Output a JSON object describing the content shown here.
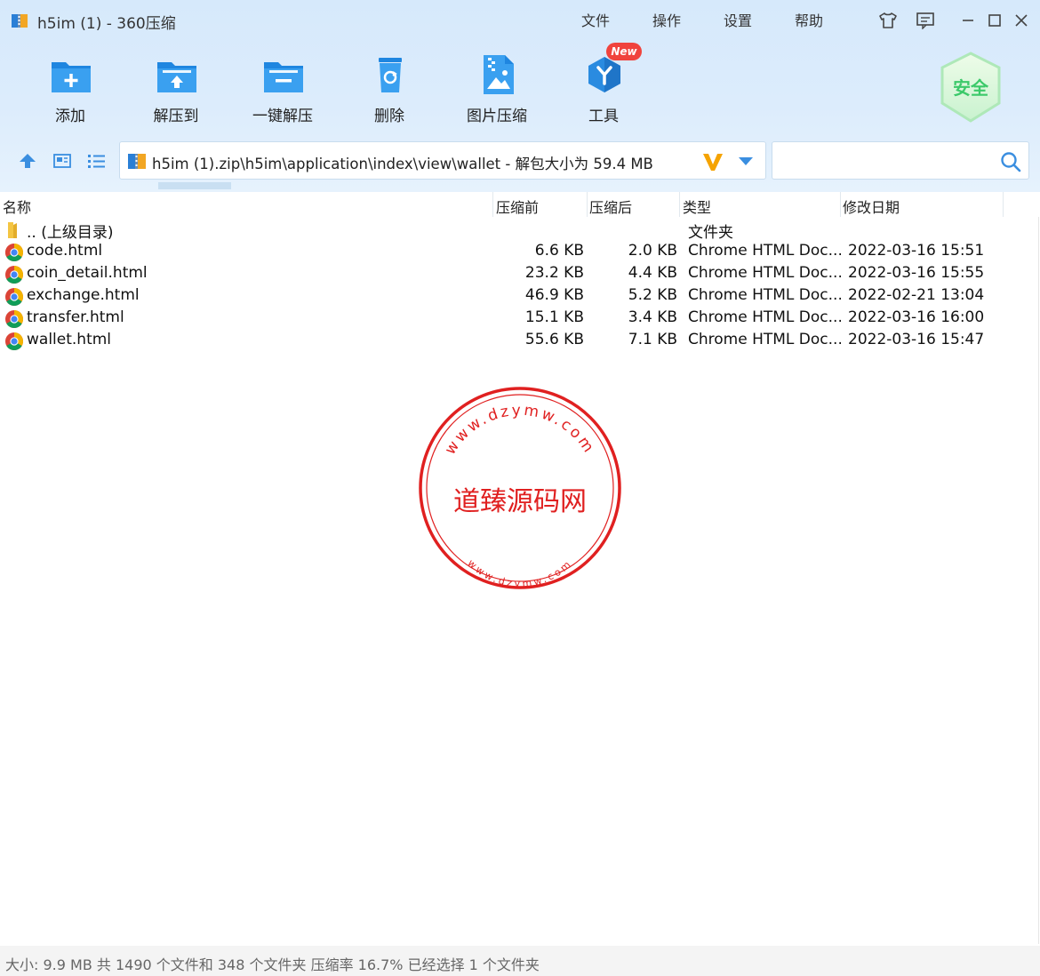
{
  "window": {
    "title": "h5im (1) - 360压缩"
  },
  "menu": {
    "file": "文件",
    "operate": "操作",
    "settings": "设置",
    "help": "帮助"
  },
  "toolbar": {
    "add": "添加",
    "extract_to": "解压到",
    "one_click": "一键解压",
    "delete": "删除",
    "image_compress": "图片压缩",
    "tools": "工具",
    "new_badge": "New"
  },
  "safe_badge": "安全",
  "address": {
    "path": "h5im (1).zip\\h5im\\application\\index\\view\\wallet - 解包大小为 59.4 MB"
  },
  "search": {
    "value": "",
    "placeholder": ""
  },
  "columns": {
    "name": "名称",
    "before": "压缩前",
    "after": "压缩后",
    "type": "类型",
    "date": "修改日期"
  },
  "files": [
    {
      "name": ".. (上级目录)",
      "before": "",
      "after": "",
      "type": "文件夹",
      "date": "",
      "icon": "folder-icon"
    },
    {
      "name": "code.html",
      "before": "6.6 KB",
      "after": "2.0 KB",
      "type": "Chrome HTML Doc...",
      "date": "2022-03-16 15:51",
      "icon": "chrome-icon"
    },
    {
      "name": "coin_detail.html",
      "before": "23.2 KB",
      "after": "4.4 KB",
      "type": "Chrome HTML Doc...",
      "date": "2022-03-16 15:55",
      "icon": "chrome-icon"
    },
    {
      "name": "exchange.html",
      "before": "46.9 KB",
      "after": "5.2 KB",
      "type": "Chrome HTML Doc...",
      "date": "2022-02-21 13:04",
      "icon": "chrome-icon"
    },
    {
      "name": "transfer.html",
      "before": "15.1 KB",
      "after": "3.4 KB",
      "type": "Chrome HTML Doc...",
      "date": "2022-03-16 16:00",
      "icon": "chrome-icon"
    },
    {
      "name": "wallet.html",
      "before": "55.6 KB",
      "after": "7.1 KB",
      "type": "Chrome HTML Doc...",
      "date": "2022-03-16 15:47",
      "icon": "chrome-icon"
    }
  ],
  "watermark": {
    "center": "道臻源码网",
    "top_arc": "www.dzymw.com",
    "bottom_arc": "www.dzymw.com"
  },
  "status": {
    "text": "大小: 9.9 MB 共 1490 个文件和 348 个文件夹 压缩率 16.7% 已经选择 1 个文件夹"
  },
  "colors": {
    "accent": "#2a8be0",
    "stamp": "#e02020",
    "safe": "#3cc96a"
  }
}
